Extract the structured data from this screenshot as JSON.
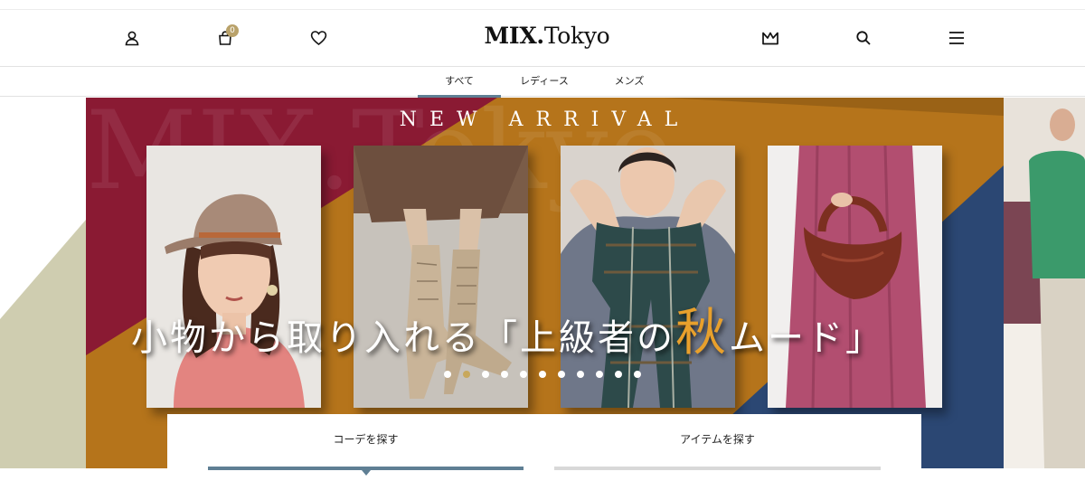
{
  "header": {
    "logo_bold": "MIX.",
    "logo_regular": "Tokyo",
    "cart_count": "0",
    "icons": [
      "user-icon",
      "cart-icon",
      "heart-icon",
      "crown-icon",
      "search-icon",
      "menu-icon"
    ]
  },
  "category_tabs": [
    {
      "label": "すべて",
      "active": true
    },
    {
      "label": "レディース",
      "active": false
    },
    {
      "label": "メンズ",
      "active": false
    }
  ],
  "hero": {
    "eyebrow": "NEW ARRIVAL",
    "headline_pre": "小物から取り入れる「上級者の",
    "headline_accent": "秋",
    "headline_post": "ムード」",
    "watermark": "MIX.Tokyo",
    "slide_count": 11,
    "active_slide": 1,
    "colors": {
      "crimson": "#8a1a33",
      "mustard": "#b5741b",
      "navy": "#2b4773",
      "sage": "#cfcdb0",
      "accent_text": "#e8a02c"
    }
  },
  "search_tabs": [
    {
      "label": "コーデを探す",
      "active": true
    },
    {
      "label": "アイテムを探す",
      "active": false
    }
  ]
}
